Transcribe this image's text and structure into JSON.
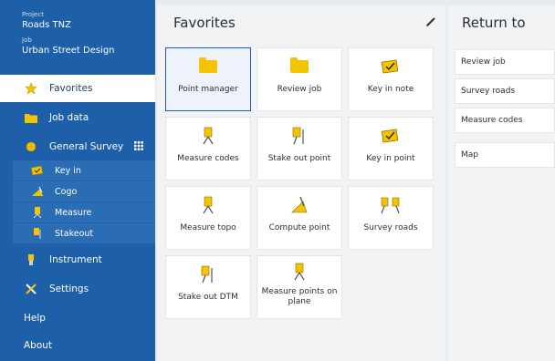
{
  "sidebar": {
    "project_label": "Project",
    "project_value": "Roads TNZ",
    "job_label": "Job",
    "job_value": "Urban Street Design",
    "items": [
      {
        "label": "Favorites",
        "icon": "star-icon"
      },
      {
        "label": "Job data",
        "icon": "folder-icon"
      },
      {
        "label": "General Survey",
        "icon": "globe-icon"
      },
      {
        "label": "Instrument",
        "icon": "instrument-icon"
      },
      {
        "label": "Settings",
        "icon": "settings-icon"
      },
      {
        "label": "Help"
      },
      {
        "label": "About"
      }
    ],
    "sub_items": [
      {
        "label": "Key in",
        "icon": "key-in-icon"
      },
      {
        "label": "Cogo",
        "icon": "cogo-icon"
      },
      {
        "label": "Measure",
        "icon": "measure-icon"
      },
      {
        "label": "Stakeout",
        "icon": "stakeout-icon"
      }
    ]
  },
  "favorites": {
    "title": "Favorites",
    "tiles": [
      {
        "label": "Point manager",
        "icon": "folder-icon"
      },
      {
        "label": "Review job",
        "icon": "folder-icon"
      },
      {
        "label": "Key in note",
        "icon": "note-icon"
      },
      {
        "label": "Measure codes",
        "icon": "measure-icon"
      },
      {
        "label": "Stake out point",
        "icon": "stakeout-icon"
      },
      {
        "label": "Key in point",
        "icon": "note-icon"
      },
      {
        "label": "Measure topo",
        "icon": "measure-icon"
      },
      {
        "label": "Compute point",
        "icon": "cogo-icon"
      },
      {
        "label": "Survey roads",
        "icon": "roads-icon"
      },
      {
        "label": "Stake out DTM",
        "icon": "stakeout-icon"
      },
      {
        "label": "Measure points on plane",
        "icon": "measure-icon"
      }
    ]
  },
  "return_to": {
    "title": "Return to",
    "items": [
      "Review job",
      "Survey roads",
      "Measure codes",
      "Map"
    ]
  },
  "colors": {
    "sidebar": "#1d5fa8",
    "sub_item_bg": "#2a6db5",
    "accent": "#f5c400"
  }
}
